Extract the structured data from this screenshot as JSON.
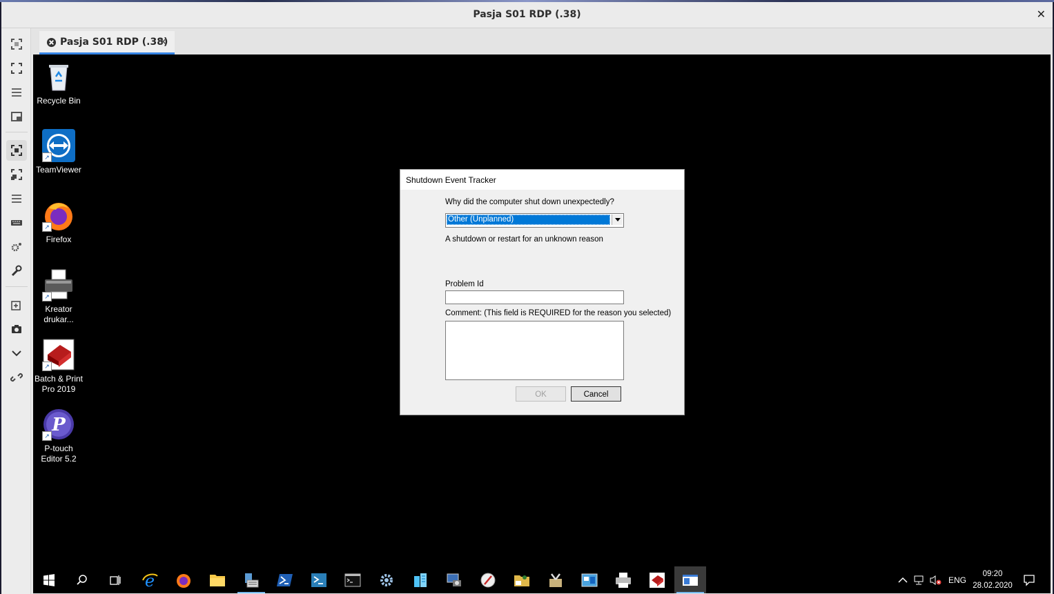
{
  "window": {
    "title": "Pasja S01 RDP (.38)",
    "close_glyph": "✕"
  },
  "tab": {
    "label": "Pasja S01 RDP (.38)",
    "close_glyph": "✕"
  },
  "sidebar": {
    "buttons": [
      "fit-screen-icon",
      "fullscreen-icon",
      "menu-icon",
      "window-icon",
      "scale-icon",
      "resize-icon",
      "list-icon",
      "keyboard-icon",
      "settings-icon",
      "wrench-icon",
      "add-icon",
      "screenshot-icon",
      "chevron-down-icon",
      "disconnect-icon"
    ]
  },
  "desktop": {
    "icons": [
      {
        "label": "Recycle Bin",
        "icon": "recycle-bin-icon"
      },
      {
        "label": "TeamViewer",
        "icon": "teamviewer-icon"
      },
      {
        "label": "Firefox",
        "icon": "firefox-icon"
      },
      {
        "label": "Kreator drukar...",
        "icon": "printer-icon"
      },
      {
        "label": "Batch & Print Pro 2019",
        "icon": "batch-print-icon"
      },
      {
        "label": "P-touch Editor 5.2",
        "icon": "ptouch-icon"
      }
    ]
  },
  "dialog": {
    "title": "Shutdown Event Tracker",
    "question": "Why did the computer shut down unexpectedly?",
    "reason_selected": "Other (Unplanned)",
    "reason_description": "A shutdown or restart for an unknown reason",
    "problem_id_label": "Problem Id",
    "problem_id_value": "",
    "comment_label": "Comment: (This field is REQUIRED for the reason you selected)",
    "comment_value": "",
    "ok_label": "OK",
    "cancel_label": "Cancel"
  },
  "taskbar": {
    "apps": [
      "windows-start-icon",
      "search-icon",
      "task-view-icon",
      "internet-explorer-icon",
      "firefox-icon",
      "file-explorer-icon",
      "server-manager-icon",
      "powershell-icon",
      "powershell-ise-icon",
      "cmd-icon",
      "settings-icon",
      "buildings-icon",
      "network-icon",
      "compass-icon",
      "folder-user-icon",
      "tools-icon",
      "control-panel-icon",
      "printer-icon",
      "batch-print-icon",
      "window-active-icon"
    ],
    "lang": "ENG",
    "time": "09:20",
    "date": "28.02.2020"
  },
  "colors": {
    "accent": "#3584e4",
    "selection": "#0078d7",
    "desktop": "#000000"
  }
}
